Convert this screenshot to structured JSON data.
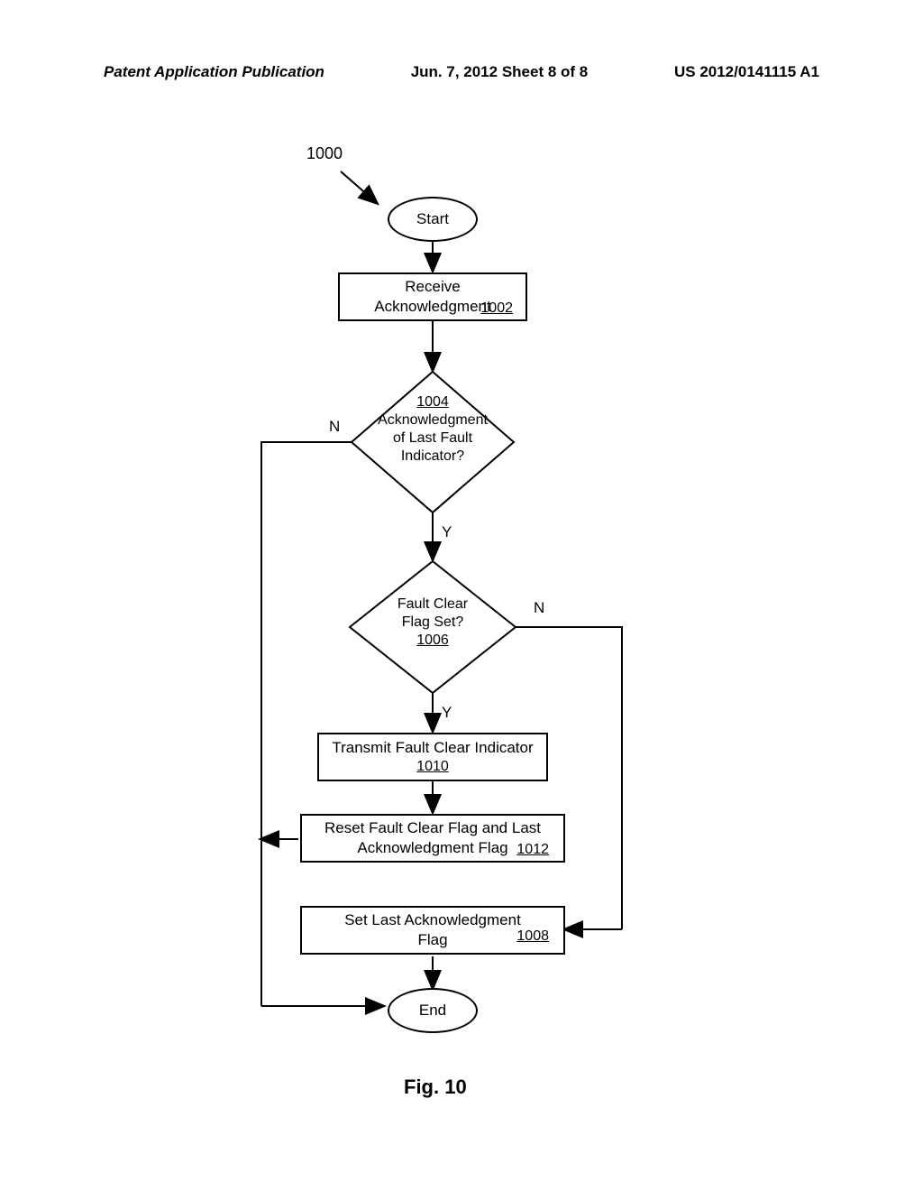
{
  "header": {
    "left": "Patent Application Publication",
    "center": "Jun. 7, 2012  Sheet 8 of 8",
    "right": "US 2012/0141115 A1"
  },
  "callout": "1000",
  "nodes": {
    "start": "Start",
    "step1002": {
      "text": "Receive\nAcknowledgment",
      "ref": "1002"
    },
    "dec1004": {
      "ref": "1004",
      "text": "Acknowledgment\nof Last Fault\nIndicator?"
    },
    "dec1006": {
      "text": "Fault Clear\nFlag Set?",
      "ref": "1006"
    },
    "step1010": {
      "text": "Transmit Fault Clear Indicator",
      "ref": "1010"
    },
    "step1012": {
      "text": "Reset Fault Clear Flag and Last\nAcknowledgment Flag",
      "ref": "1012"
    },
    "step1008": {
      "text": "Set Last Acknowledgment\nFlag",
      "ref": "1008"
    },
    "end": "End"
  },
  "edge_labels": {
    "dec1004_no": "N",
    "dec1004_yes": "Y",
    "dec1006_no": "N",
    "dec1006_yes": "Y"
  },
  "figure_caption": "Fig. 10",
  "chart_data": {
    "type": "flowchart",
    "title": "Fig. 10",
    "reference_numeral": "1000",
    "nodes": [
      {
        "id": "start",
        "type": "terminator",
        "label": "Start"
      },
      {
        "id": "1002",
        "type": "process",
        "label": "Receive Acknowledgment"
      },
      {
        "id": "1004",
        "type": "decision",
        "label": "Acknowledgment of Last Fault Indicator?"
      },
      {
        "id": "1006",
        "type": "decision",
        "label": "Fault Clear Flag Set?"
      },
      {
        "id": "1010",
        "type": "process",
        "label": "Transmit Fault Clear Indicator"
      },
      {
        "id": "1012",
        "type": "process",
        "label": "Reset Fault Clear Flag and Last Acknowledgment Flag"
      },
      {
        "id": "1008",
        "type": "process",
        "label": "Set Last Acknowledgment Flag"
      },
      {
        "id": "end",
        "type": "terminator",
        "label": "End"
      }
    ],
    "edges": [
      {
        "from": "start",
        "to": "1002"
      },
      {
        "from": "1002",
        "to": "1004"
      },
      {
        "from": "1004",
        "to": "1006",
        "label": "Y"
      },
      {
        "from": "1004",
        "to": "end",
        "label": "N"
      },
      {
        "from": "1006",
        "to": "1010",
        "label": "Y"
      },
      {
        "from": "1006",
        "to": "1008",
        "label": "N"
      },
      {
        "from": "1010",
        "to": "1012"
      },
      {
        "from": "1012",
        "to": "end"
      },
      {
        "from": "1008",
        "to": "end"
      }
    ]
  }
}
